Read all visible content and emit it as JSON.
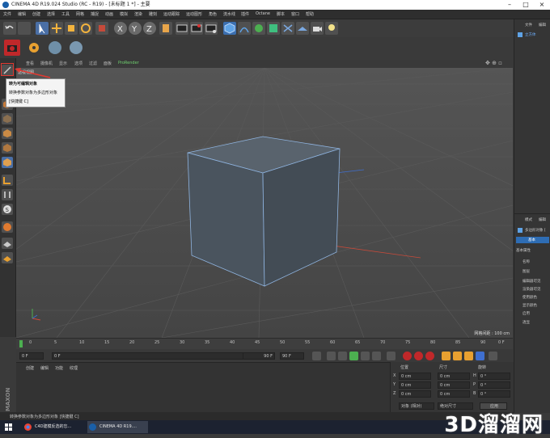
{
  "window": {
    "title": "CINEMA 4D R19.024 Studio (RC - R19) - [未标题 1 *] - 主要"
  },
  "menubar": {
    "items": [
      "文件",
      "编辑",
      "创建",
      "选择",
      "工具",
      "网格",
      "捕捉",
      "动画",
      "模拟",
      "渲染",
      "雕刻",
      "运动跟踪",
      "运动图形",
      "角色",
      "流水线",
      "插件",
      "Octane",
      "脚本",
      "窗口",
      "帮助"
    ]
  },
  "viewport": {
    "menu": [
      "查看",
      "摄像机",
      "显示",
      "选项",
      "过滤",
      "面板",
      "ProRender"
    ],
    "label": "透视视图",
    "grid_info": "网格间距 : 100 cm"
  },
  "tooltip": {
    "title": "转为可编辑对象",
    "desc": "转换参数对象为多边形对象",
    "shortcut": "[快捷键 C]"
  },
  "timeline": {
    "ticks": [
      "0",
      "5",
      "10",
      "15",
      "20",
      "25",
      "30",
      "35",
      "40",
      "45",
      "50",
      "55",
      "60",
      "65",
      "70",
      "75",
      "80",
      "85",
      "90"
    ],
    "end_label": "0 F"
  },
  "transport": {
    "start": "0 F",
    "current": "0 F",
    "range_end": "90 F",
    "end": "90 F"
  },
  "materials": {
    "menu": [
      "创建",
      "编辑",
      "功能",
      "纹理"
    ]
  },
  "coords": {
    "headers": [
      "位置",
      "尺寸",
      "旋转"
    ],
    "rows": [
      {
        "axis": "X",
        "pos": "0 cm",
        "size": "0 cm",
        "rot_axis": "H",
        "rot": "0 °"
      },
      {
        "axis": "Y",
        "pos": "0 cm",
        "size": "0 cm",
        "rot_axis": "P",
        "rot": "0 °"
      },
      {
        "axis": "Z",
        "pos": "0 cm",
        "size": "0 cm",
        "rot_axis": "B",
        "rot": "0 °"
      }
    ],
    "mode": "对象 (相对)",
    "size_mode": "绝对尺寸",
    "apply": "应用"
  },
  "objects_panel": {
    "tabs": [
      "文件",
      "编辑"
    ],
    "item": "立方体"
  },
  "attributes_panel": {
    "tabs": [
      "模式",
      "编辑"
    ],
    "object": "多边形对象 [",
    "tab": "基本",
    "section": "基本属性",
    "fields": [
      "名称",
      "图层",
      "编辑器可见",
      "渲染器可见",
      "使用颜色",
      "显示颜色",
      "启用",
      "透显"
    ]
  },
  "statusbar": {
    "text": "转换参数对象为多边形对象 [快捷键 C]"
  },
  "taskbar": {
    "items": [
      "C4D建模反选的忘...",
      "CINEMA 4D R19...."
    ]
  },
  "watermark": "3D溜溜网",
  "colors": {
    "accent_blue": "#2e6db4",
    "highlight_red": "#e23a32",
    "cube_face": "#4c5560",
    "cube_edge": "#8fb4e0"
  }
}
